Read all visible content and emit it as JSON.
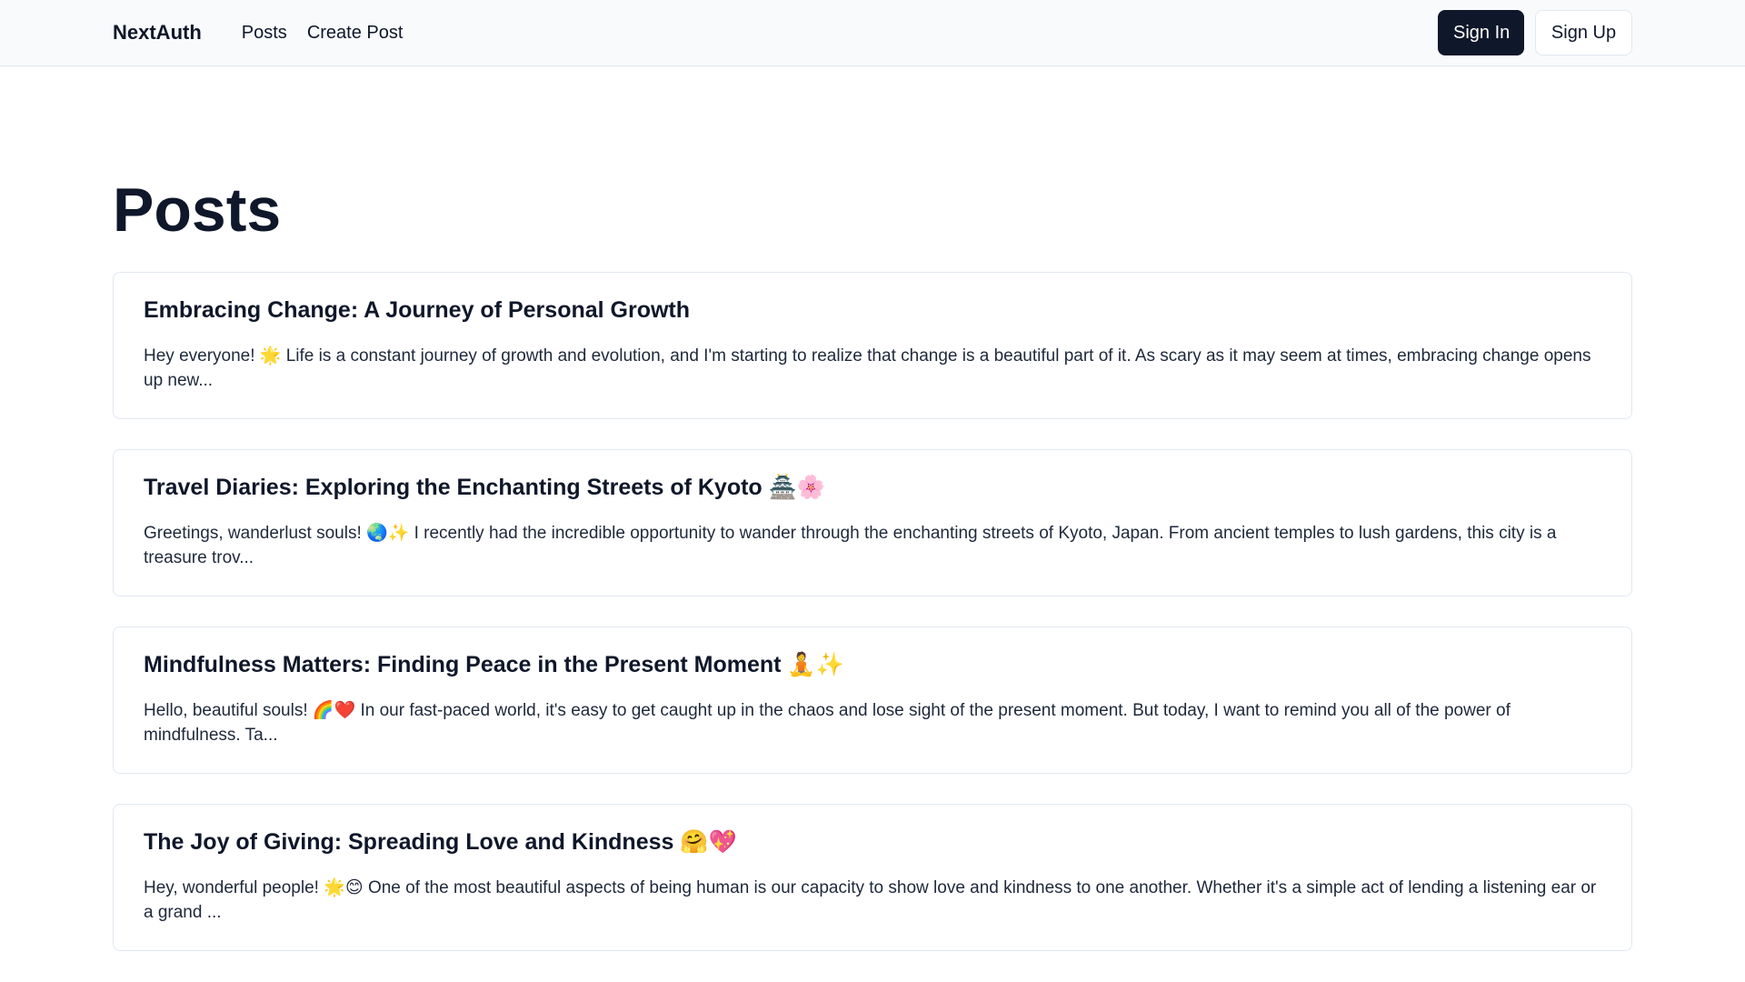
{
  "header": {
    "brand": "NextAuth",
    "nav": [
      {
        "label": "Posts"
      },
      {
        "label": "Create Post"
      }
    ],
    "sign_in_label": "Sign In",
    "sign_up_label": "Sign Up"
  },
  "main": {
    "title": "Posts",
    "posts": [
      {
        "title": "Embracing Change: A Journey of Personal Growth",
        "excerpt": "Hey everyone! 🌟 Life is a constant journey of growth and evolution, and I'm starting to realize that change is a beautiful part of it. As scary as it may seem at times, embracing change opens up new..."
      },
      {
        "title": "Travel Diaries: Exploring the Enchanting Streets of Kyoto 🏯🌸",
        "excerpt": "Greetings, wanderlust souls! 🌏✨ I recently had the incredible opportunity to wander through the enchanting streets of Kyoto, Japan. From ancient temples to lush gardens, this city is a treasure trov..."
      },
      {
        "title": "Mindfulness Matters: Finding Peace in the Present Moment 🧘✨",
        "excerpt": "Hello, beautiful souls! 🌈❤️ In our fast-paced world, it's easy to get caught up in the chaos and lose sight of the present moment. But today, I want to remind you all of the power of mindfulness. Ta..."
      },
      {
        "title": "The Joy of Giving: Spreading Love and Kindness 🤗💖",
        "excerpt": "Hey, wonderful people! 🌟😊 One of the most beautiful aspects of being human is our capacity to show love and kindness to one another. Whether it's a simple act of lending a listening ear or a grand ..."
      }
    ]
  },
  "colors": {
    "header_bg": "#f8fafc",
    "primary": "#0f172a",
    "border": "#e2e8f0",
    "text": "#0f172a"
  }
}
